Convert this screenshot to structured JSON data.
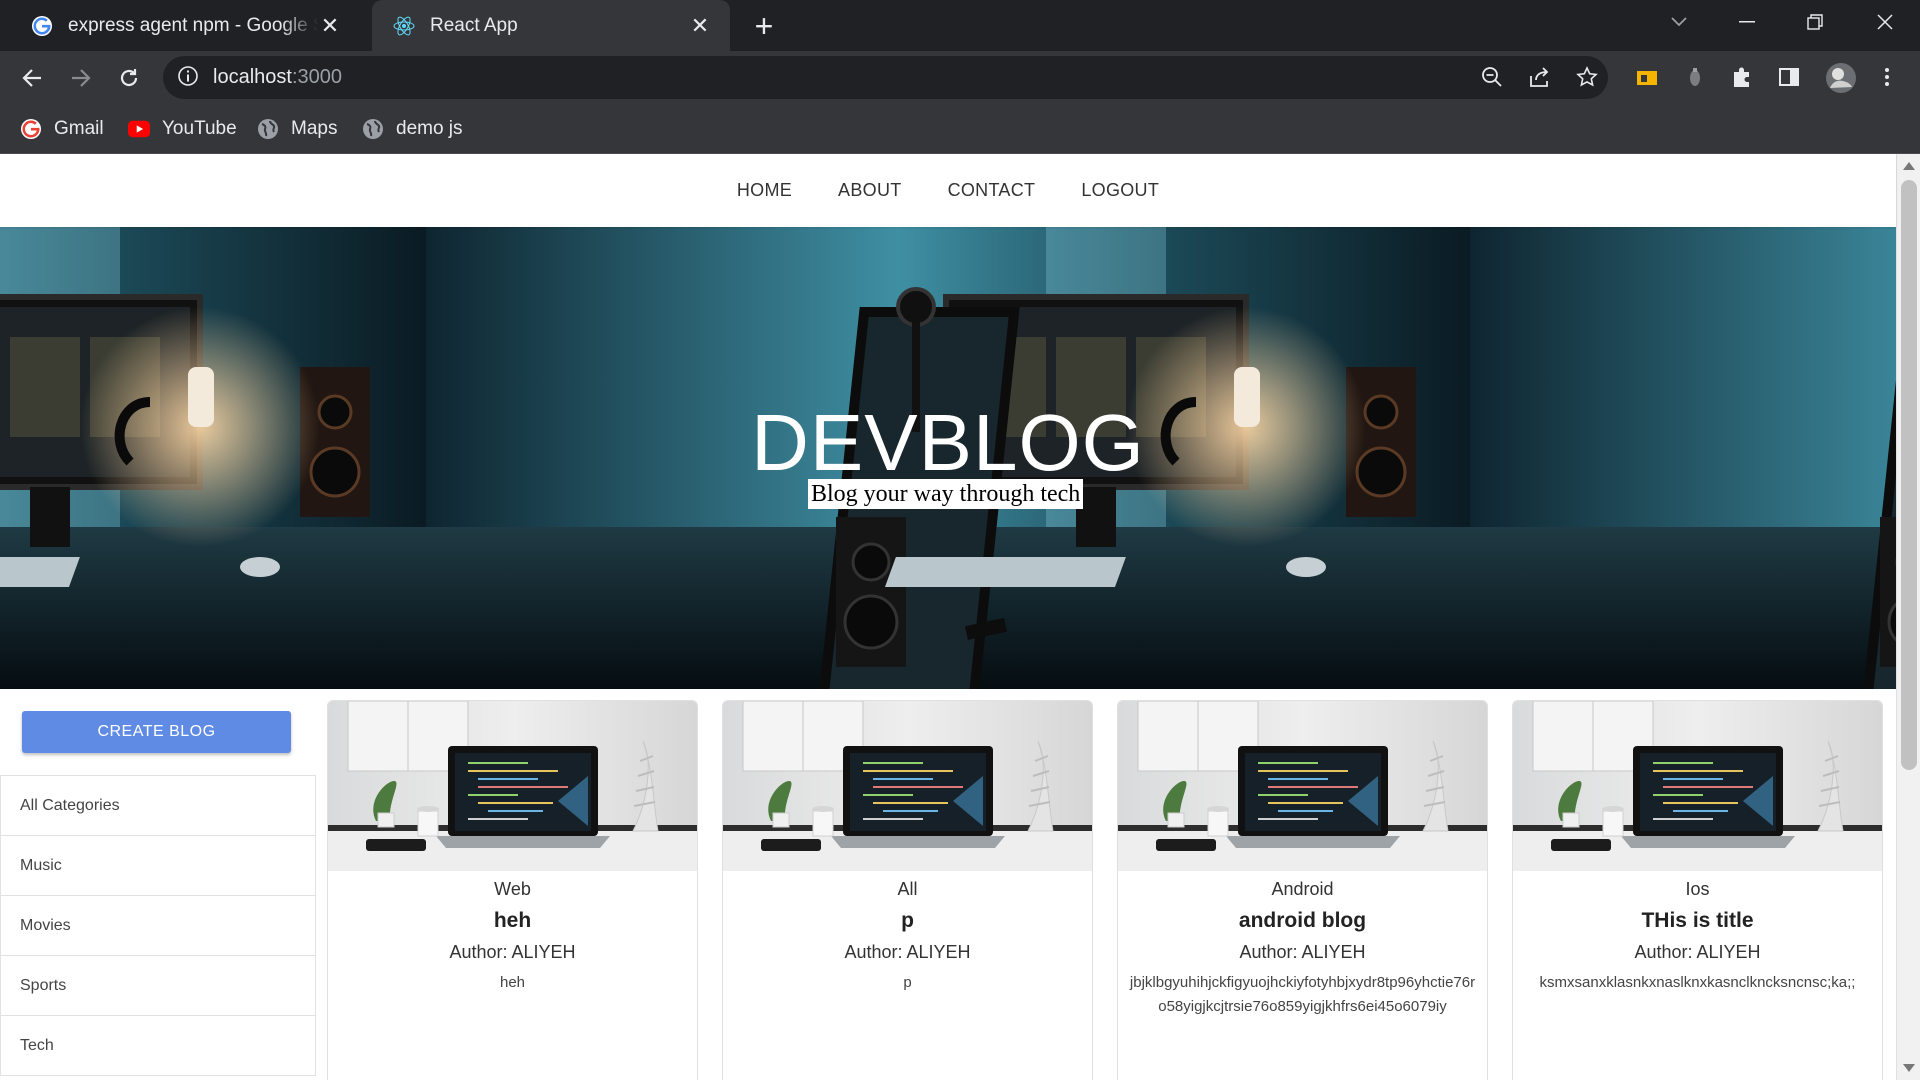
{
  "browser": {
    "tabs": [
      {
        "title": "express agent npm - Google Search",
        "active": false,
        "favicon": "google-icon"
      },
      {
        "title": "React App",
        "active": true,
        "favicon": "react-icon"
      }
    ],
    "url_host": "localhost",
    "url_port": ":3000",
    "bookmarks": [
      {
        "label": "Gmail",
        "icon": "google-icon"
      },
      {
        "label": "YouTube",
        "icon": "youtube-icon"
      },
      {
        "label": "Maps",
        "icon": "globe-icon"
      },
      {
        "label": "demo js",
        "icon": "globe-icon"
      }
    ]
  },
  "site": {
    "nav": [
      "HOME",
      "ABOUT",
      "CONTACT",
      "LOGOUT"
    ],
    "hero_title": "DEVBLOG",
    "hero_subtitle": "Blog your way through tech",
    "create_button": "CREATE BLOG",
    "categories": [
      "All Categories",
      "Music",
      "Movies",
      "Sports",
      "Tech"
    ],
    "posts": [
      {
        "category": "Web",
        "title": "heh",
        "author": "Author: ALIYEH",
        "desc": "heh"
      },
      {
        "category": "All",
        "title": "p",
        "author": "Author: ALIYEH",
        "desc": "p"
      },
      {
        "category": "Android",
        "title": "android blog",
        "author": "Author: ALIYEH",
        "desc": "jbjklbgyuhihjckfigyuojhckiyfotyhbjxydr8tp96yhctie76ro58yigjkcjtrsie76o859yigjkhfrs6ei45o6079iy"
      },
      {
        "category": "Ios",
        "title": "THis is title",
        "author": "Author: ALIYEH",
        "desc": "ksmxsanxklasnkxnaslknxkasnclkncksncnsc;ka;;"
      }
    ]
  },
  "colors": {
    "chrome_dark": "#202124",
    "chrome_toolbar": "#35363a",
    "create_button": "#5f8be4"
  }
}
